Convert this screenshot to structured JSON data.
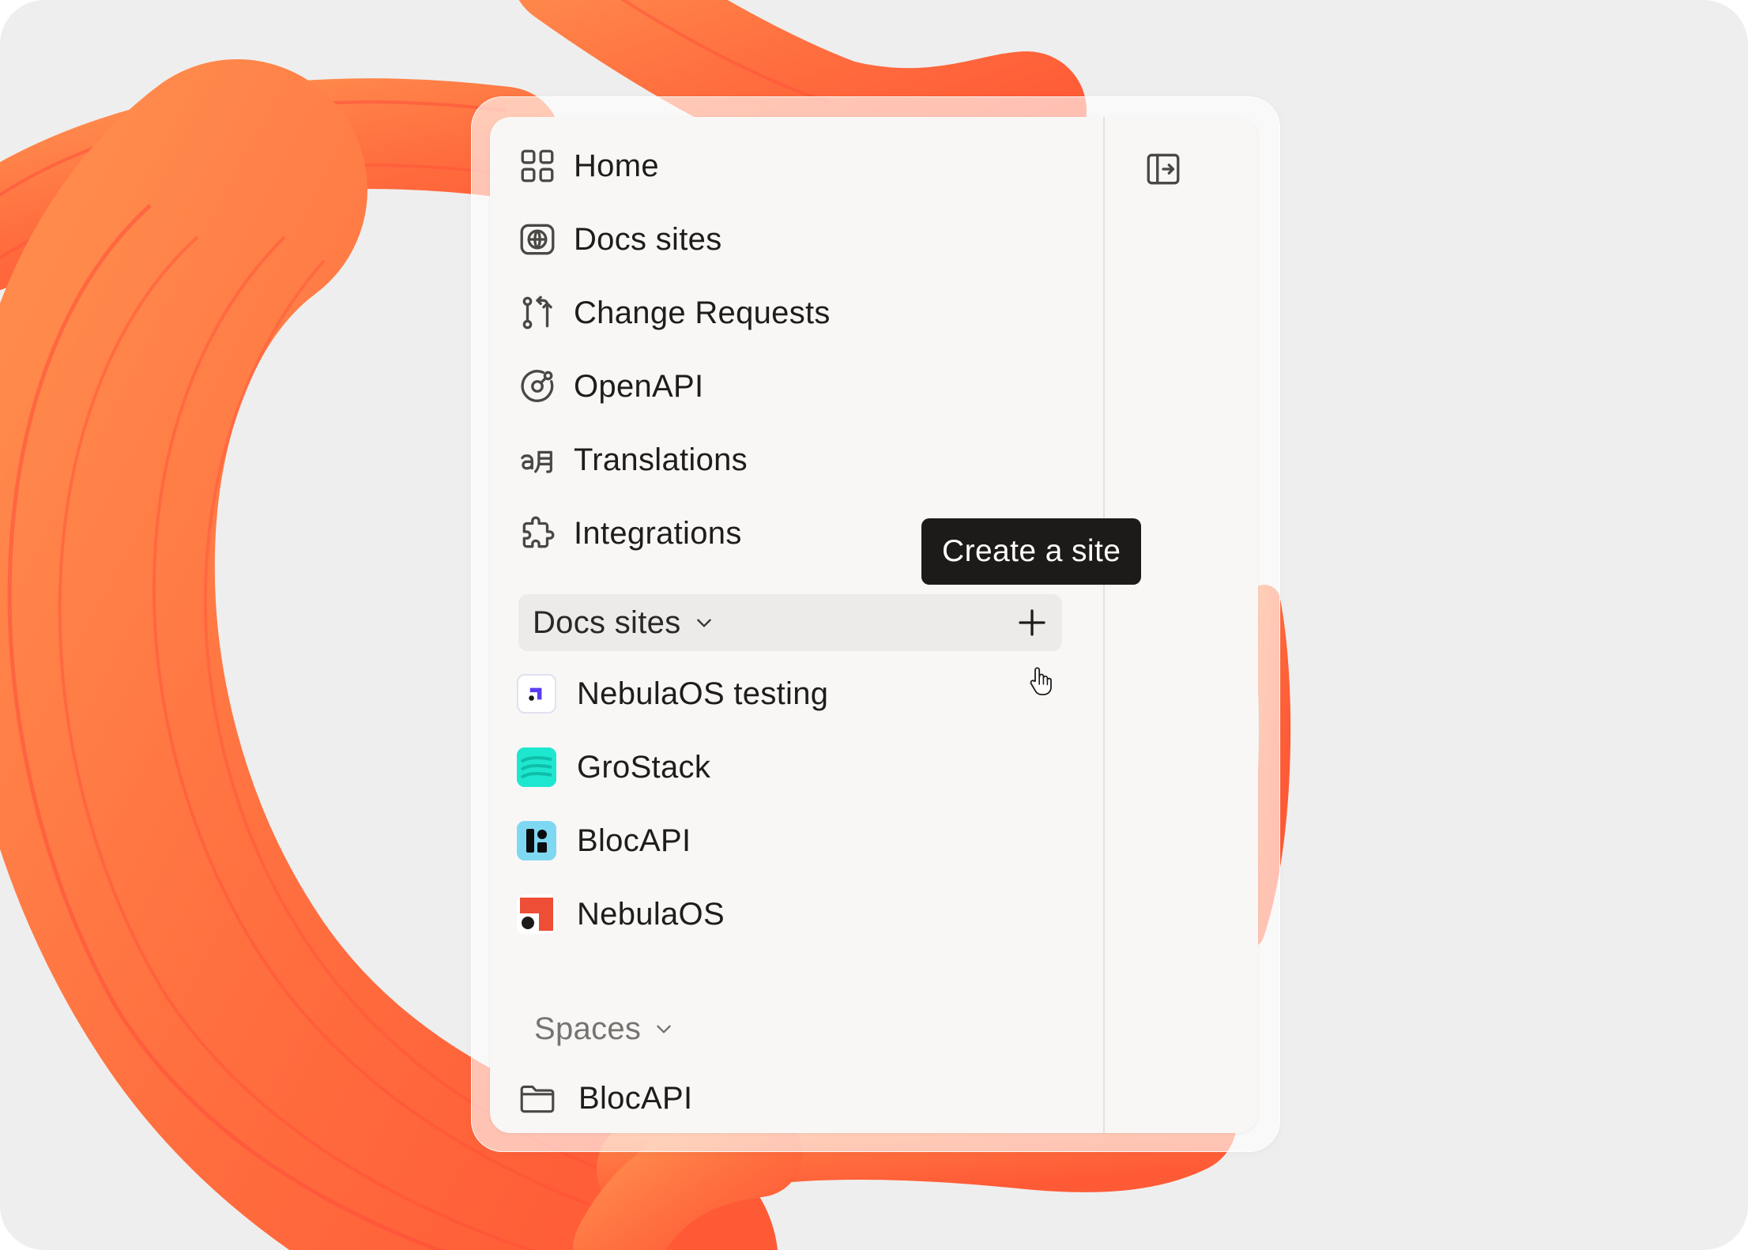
{
  "nav": [
    {
      "label": "Home",
      "icon": "home-grid-icon"
    },
    {
      "label": "Docs sites",
      "icon": "globe-icon"
    },
    {
      "label": "Change Requests",
      "icon": "branch-icon"
    },
    {
      "label": "OpenAPI",
      "icon": "openapi-icon"
    },
    {
      "label": "Translations",
      "icon": "translate-icon"
    },
    {
      "label": "Integrations",
      "icon": "puzzle-icon"
    }
  ],
  "docs_section": {
    "label": "Docs sites",
    "sites": [
      {
        "label": "NebulaOS testing",
        "icon": "nebulaos-testing-logo"
      },
      {
        "label": "GroStack",
        "icon": "grostack-logo"
      },
      {
        "label": "BlocAPI",
        "icon": "blocapi-logo"
      },
      {
        "label": "NebulaOS",
        "icon": "nebulaos-logo"
      }
    ]
  },
  "spaces_section": {
    "label": "Spaces",
    "items": [
      {
        "label": "BlocAPI",
        "icon": "folder-icon"
      }
    ]
  },
  "tooltip": {
    "label": "Create a site"
  },
  "colors": {
    "accent": "#ff6a3d",
    "tooltip_bg": "#1d1b19",
    "panel_bg": "#f8f7f6"
  }
}
